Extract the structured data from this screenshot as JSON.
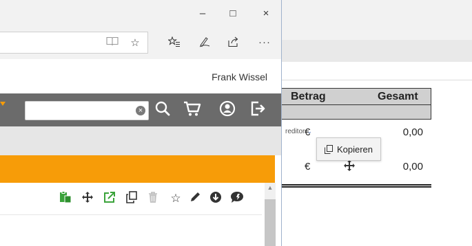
{
  "background_window": {
    "kreditor_label": "reditor",
    "table": {
      "headers": [
        "Betrag",
        "Gesamt"
      ],
      "rows": [
        {
          "currency": "€",
          "value": "0,00"
        },
        {
          "currency": "€",
          "value": "0,00"
        }
      ]
    },
    "tooltip": {
      "label": "Kopieren"
    }
  },
  "browser": {
    "window_controls": {
      "minimize": "–",
      "maximize": "□",
      "close": "×"
    },
    "toolbar_icons": [
      "reading-view-icon",
      "favorite-star-icon",
      "favorites-hub-icon",
      "pen-icon",
      "share-icon",
      "more-icon"
    ],
    "more_label": "···",
    "user_name": "Frank Wissel",
    "search": {
      "value": "",
      "placeholder": ""
    },
    "nav_icons": [
      "search-icon",
      "cart-icon",
      "account-icon",
      "logout-icon"
    ],
    "action_icons": [
      "paste-icon",
      "move-icon",
      "external-link-icon",
      "copy-icon",
      "trash-icon",
      "star-icon",
      "pencil-icon",
      "download-icon",
      "comment-icon"
    ]
  },
  "colors": {
    "nav_background": "#6b6b6b",
    "accent_orange": "#f79c08",
    "action_green": "#3aa33a",
    "table_header_bg": "#d0d0d0"
  }
}
